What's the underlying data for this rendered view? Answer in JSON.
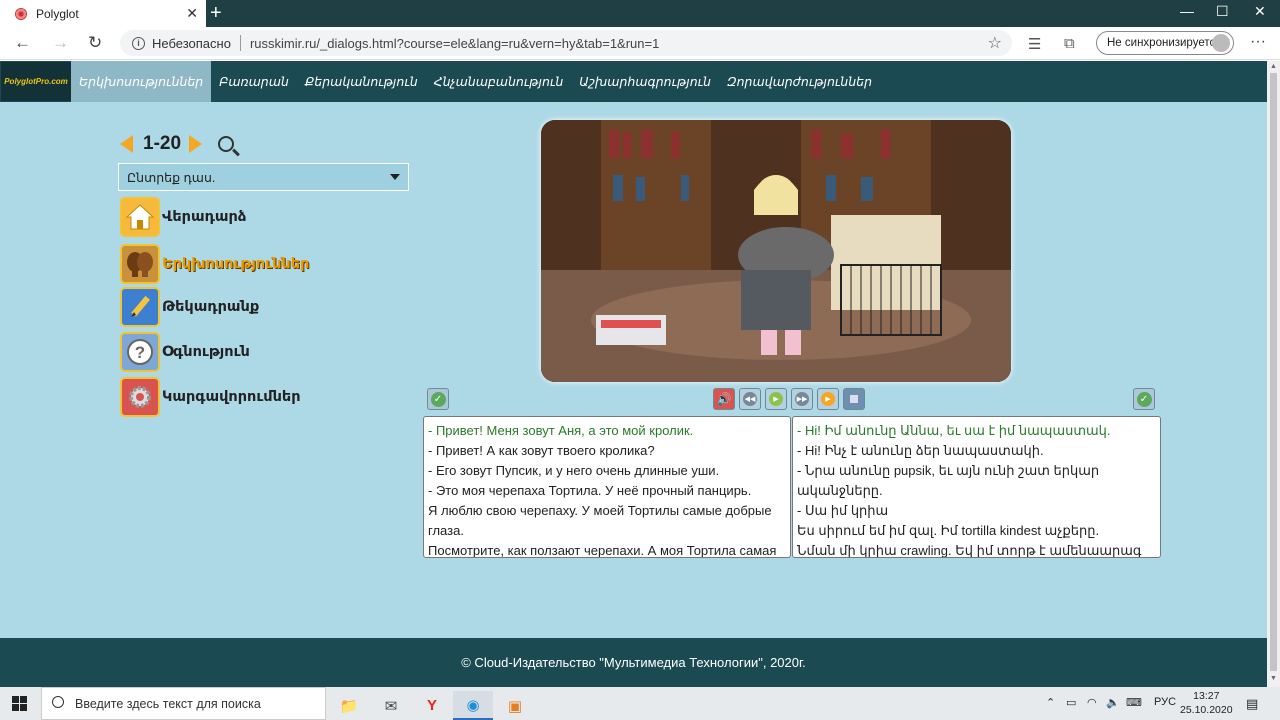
{
  "browser": {
    "tab_title": "Polyglot",
    "new_tab": "+",
    "insecure_label": "Небезопасно",
    "url": "russkimir.ru/_dialogs.html?course=ele&lang=ru&vern=hy&tab=1&run=1",
    "sync_label": "Не синхронизируется"
  },
  "site": {
    "logo": "PolyglotPro.com",
    "nav": [
      {
        "label": "Երկխոսություններ"
      },
      {
        "label": "Բառարան"
      },
      {
        "label": "Քերականություն"
      },
      {
        "label": "Հնչանաբանություն"
      },
      {
        "label": "Աշխարհագրություն"
      },
      {
        "label": "Զորավարժություններ"
      }
    ],
    "pager_label": "1-20",
    "lesson_select": "Ընտրեք դաս.",
    "menu": [
      {
        "label": "Վերադարձ",
        "icon": "home-icon"
      },
      {
        "label": "Երկխոսություններ",
        "icon": "people-icon"
      },
      {
        "label": "Թեկադրանք",
        "icon": "pencil-icon"
      },
      {
        "label": "Օգնություն",
        "icon": "help-icon"
      },
      {
        "label": "Կարգավորումներ",
        "icon": "gear-icon"
      }
    ],
    "russian_lines": [
      "- Привет! Меня зовут Аня, а это мой кролик.",
      "- Привет! А как зовут твоего кролика?",
      "- Его зовут Пупсик, и у него очень длинные уши.",
      "- Это моя черепаха Тортила. У неё прочный панцирь.",
      "Я люблю свою черепаху. У моей Тортилы самые добрые глаза.",
      "Посмотрите, как ползают черепахи. А моя Тортила самая"
    ],
    "armenian_lines": [
      "- Hi! Իմ անունը Աննա, եւ սա է իմ նապաստակ.",
      "- Hi! Ինչ է անունը ձեր նապաստակի.",
      "- Նրա անունը pupsik, եւ այն ունի շատ երկար ականջները.",
      "- Սա իմ կրիա",
      "Ես սիրում եմ իմ զալ. Իմ tortilla kindest աչքերը.",
      "Նման մի կրիա crawling. Եվ իմ տորթ է ամենաարագ բոլոր"
    ],
    "footer": "© Cloud-Издательство \"Мультимедиа Технологии\", 2020г."
  },
  "taskbar": {
    "search_placeholder": "Введите здесь текст для поиска",
    "lang": "РУС",
    "time": "13:27",
    "date": "25.10.2020"
  },
  "colors": {
    "site_bg": "#add8e6",
    "nav_bg": "#1c4a52",
    "accent": "#f5a623",
    "highlight_text": "#2a7a2a"
  }
}
